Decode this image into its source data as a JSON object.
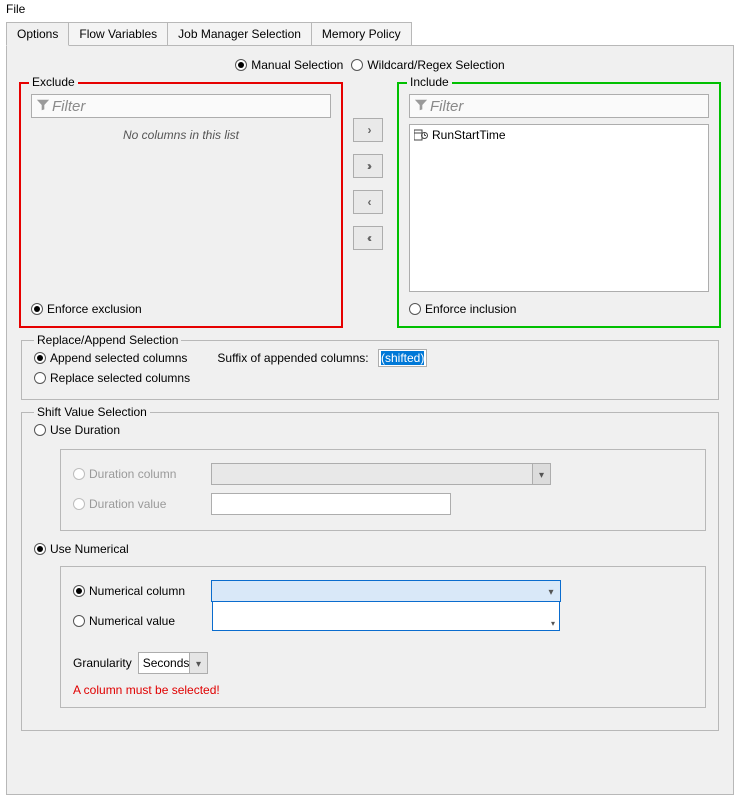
{
  "menubar": {
    "file": "File"
  },
  "tabs": {
    "options": "Options",
    "flow_variables": "Flow Variables",
    "job_manager": "Job Manager Selection",
    "memory_policy": "Memory Policy"
  },
  "selection_mode": {
    "manual": "Manual Selection",
    "wildcard": "Wildcard/Regex Selection"
  },
  "exclude": {
    "legend": "Exclude",
    "filter_placeholder": "Filter",
    "empty_text": "No columns in this list",
    "enforce": "Enforce exclusion"
  },
  "include": {
    "legend": "Include",
    "filter_placeholder": "Filter",
    "enforce": "Enforce inclusion",
    "items": [
      "RunStartTime"
    ]
  },
  "move_buttons": {
    "add": "›",
    "add_all": "››",
    "remove": "‹",
    "remove_all": "‹‹"
  },
  "replace_append": {
    "legend": "Replace/Append Selection",
    "append": "Append selected columns",
    "suffix_label": "Suffix of appended columns:",
    "suffix_value": "(shifted)",
    "replace": "Replace selected columns"
  },
  "shift": {
    "legend": "Shift Value Selection",
    "use_duration": "Use Duration",
    "duration_column": "Duration column",
    "duration_value": "Duration value",
    "use_numerical": "Use Numerical",
    "numerical_column": "Numerical column",
    "numerical_value": "Numerical value",
    "granularity_label": "Granularity",
    "granularity_value": "Seconds",
    "error": "A column must be selected!"
  }
}
